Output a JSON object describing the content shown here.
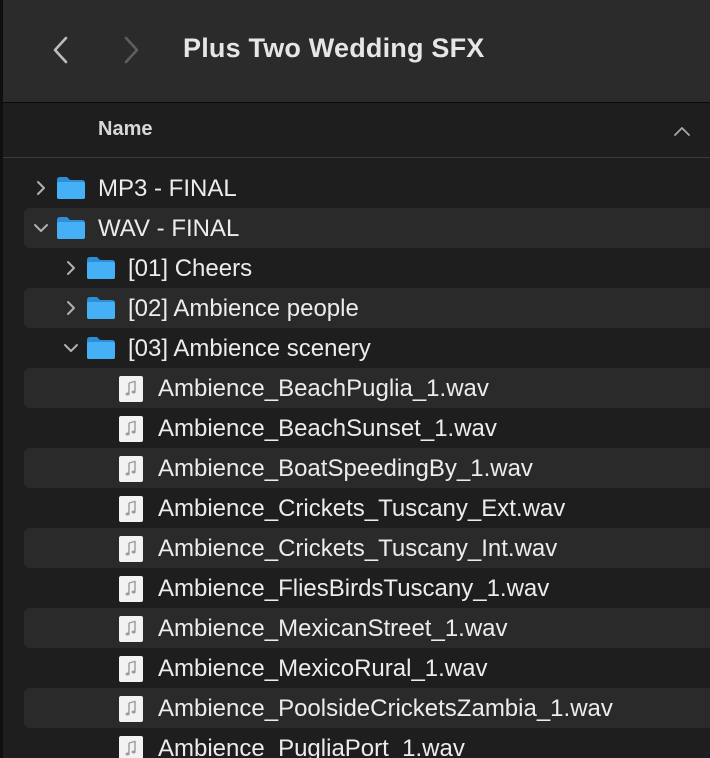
{
  "window": {
    "title": "Plus Two Wedding SFX"
  },
  "toolbar": {
    "back_icon": "chevron-left-icon",
    "forward_icon": "chevron-right-icon"
  },
  "columns": {
    "name_header": "Name",
    "sort_icon": "chevron-up-icon"
  },
  "colors": {
    "folder": "#3fa9f5",
    "row_stripe": "#2a2a2a",
    "background": "#1e1e1e"
  },
  "rows": [
    {
      "label": "MP3 - FINAL",
      "type": "folder",
      "expanded": false
    },
    {
      "label": "WAV - FINAL",
      "type": "folder",
      "expanded": true
    },
    {
      "label": "[01] Cheers",
      "type": "folder",
      "expanded": false
    },
    {
      "label": "[02] Ambience people",
      "type": "folder",
      "expanded": false
    },
    {
      "label": "[03] Ambience scenery",
      "type": "folder",
      "expanded": true
    },
    {
      "label": "Ambience_BeachPuglia_1.wav",
      "type": "file"
    },
    {
      "label": "Ambience_BeachSunset_1.wav",
      "type": "file"
    },
    {
      "label": "Ambience_BoatSpeedingBy_1.wav",
      "type": "file"
    },
    {
      "label": "Ambience_Crickets_Tuscany_Ext.wav",
      "type": "file"
    },
    {
      "label": "Ambience_Crickets_Tuscany_Int.wav",
      "type": "file"
    },
    {
      "label": "Ambience_FliesBirdsTuscany_1.wav",
      "type": "file"
    },
    {
      "label": "Ambience_MexicanStreet_1.wav",
      "type": "file"
    },
    {
      "label": "Ambience_MexicoRural_1.wav",
      "type": "file"
    },
    {
      "label": "Ambience_PoolsideCricketsZambia_1.wav",
      "type": "file"
    },
    {
      "label": "Ambience_PugliaPort_1.wav",
      "type": "file"
    }
  ]
}
